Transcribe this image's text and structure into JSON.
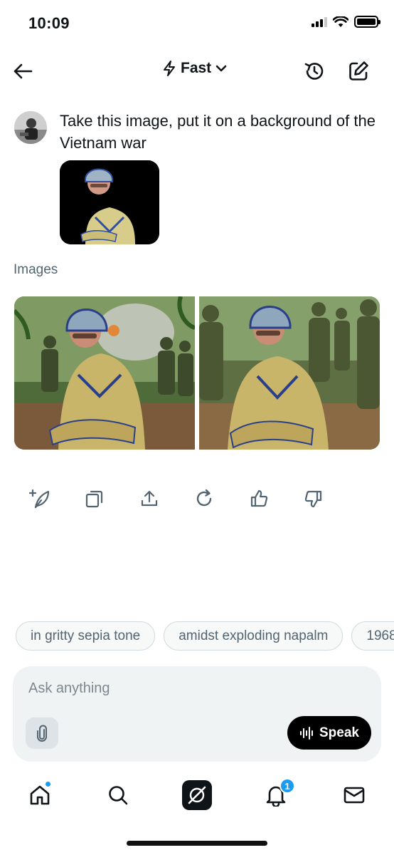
{
  "status_bar": {
    "time": "10:09"
  },
  "header": {
    "mode_label": "Fast"
  },
  "message": {
    "text": "Take this image, put it on a background of the Vietnam war"
  },
  "images_section": {
    "label": "Images"
  },
  "suggestions": [
    "in gritty sepia tone",
    "amidst exploding napalm",
    "1968"
  ],
  "composer": {
    "placeholder": "Ask anything",
    "speak_label": "Speak"
  },
  "tabbar": {
    "notification_count": "1"
  },
  "colors": {
    "accent": "#1d9bf0",
    "chip_border": "#cfd9de",
    "composer_bg": "#eff3f4",
    "muted_text": "#536471"
  },
  "icons": [
    "back-arrow-icon",
    "lightning-icon",
    "chevron-down-icon",
    "history-icon",
    "compose-icon",
    "sparkle-leaf-icon",
    "copy-icon",
    "share-icon",
    "regenerate-icon",
    "thumbs-up-icon",
    "thumbs-down-icon",
    "paperclip-icon",
    "voice-waveform-icon",
    "home-icon",
    "search-icon",
    "grok-icon",
    "bell-icon",
    "mail-icon"
  ]
}
